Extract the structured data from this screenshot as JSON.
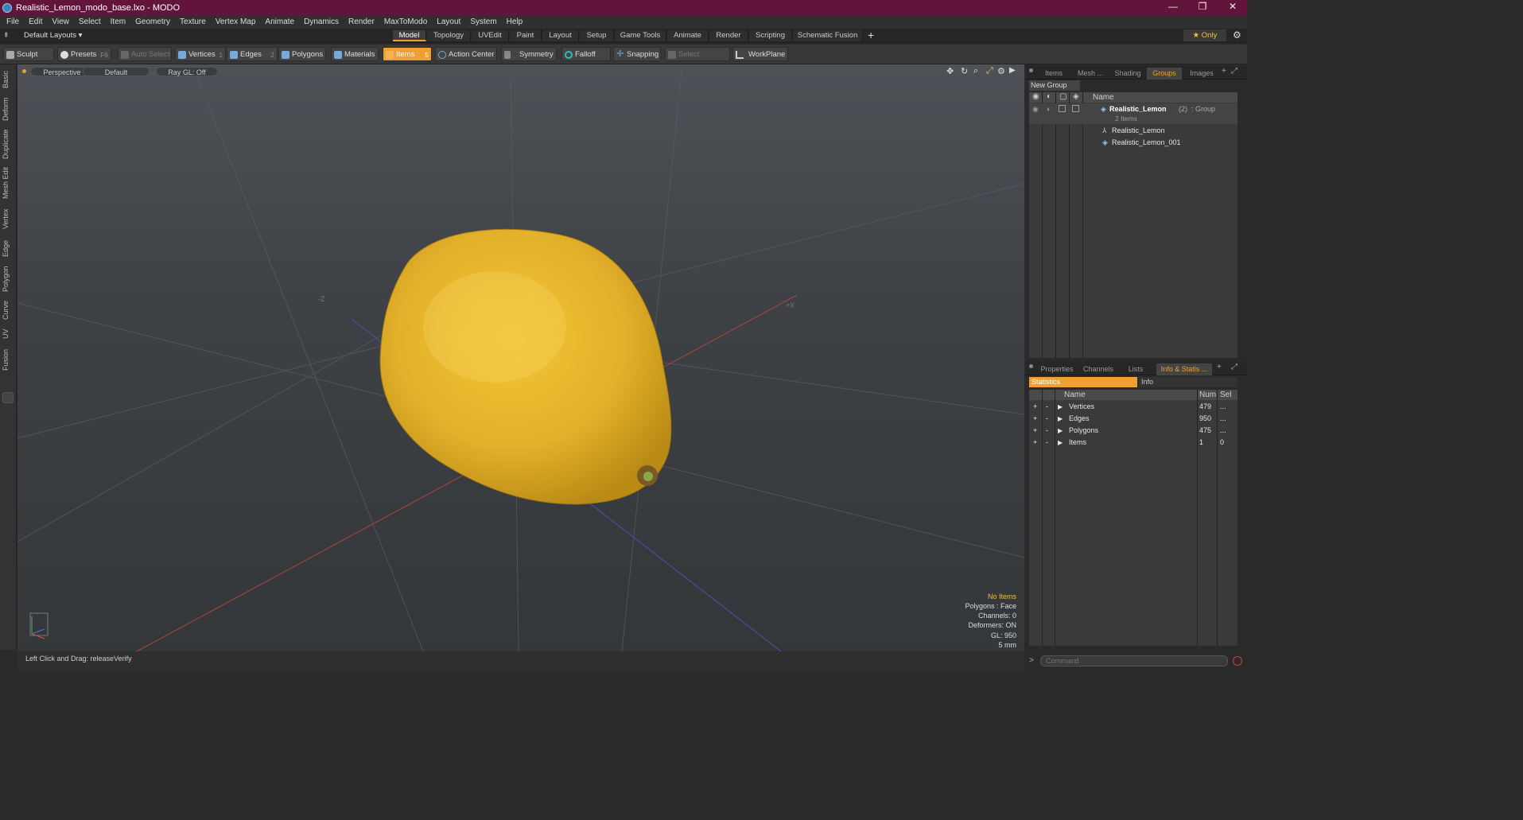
{
  "window": {
    "title": "Realistic_Lemon_modo_base.lxo - MODO",
    "minimize": "—",
    "maximize": "❐",
    "close": "✕"
  },
  "menu": [
    "File",
    "Edit",
    "View",
    "Select",
    "Item",
    "Geometry",
    "Texture",
    "Vertex Map",
    "Animate",
    "Dynamics",
    "Render",
    "MaxToModo",
    "Layout",
    "System",
    "Help"
  ],
  "layout": {
    "selector": "Default Layouts ▾",
    "tabs": [
      "Model",
      "Topology",
      "UVEdit",
      "Paint",
      "Layout",
      "Setup",
      "Game Tools",
      "Animate",
      "Render",
      "Scripting",
      "Schematic Fusion"
    ],
    "active_tab": "Model",
    "add": "+",
    "only": "★  Only"
  },
  "toolbar": {
    "sculpt": "Sculpt",
    "presets": "Presets",
    "presets_key": "F6",
    "auto_select": "Auto Select",
    "vertices": "Vertices",
    "vertices_key": "1",
    "edges": "Edges",
    "edges_key": "2",
    "polygons": "Polygons",
    "materials": "Materials",
    "items": "Items",
    "items_key": "5",
    "action_center": "Action Center",
    "symmetry": "Symmetry",
    "falloff": "Falloff",
    "snapping": "Snapping",
    "select_through": "Select Through",
    "workplane": "WorkPlane"
  },
  "left_tabs": [
    "Basic",
    "Deform",
    "Duplicate",
    "Mesh Edit",
    "Vertex",
    "Edge",
    "Polygon",
    "Curve",
    "UV",
    "Fusion"
  ],
  "viewport": {
    "view": "Perspective",
    "shading": "Default",
    "raygl": "Ray GL: Off",
    "axis_neg_z": "-Z",
    "axis_pos_x": "+X",
    "info": {
      "items": "No Items",
      "polygons": "Polygons : Face",
      "channels": "Channels: 0",
      "deformers": "Deformers: ON",
      "gl": "GL: 950",
      "unit": "5 mm"
    }
  },
  "status": {
    "hint": "Left Click and Drag:  releaseVerify"
  },
  "groups_panel": {
    "tabs": [
      "Items",
      "Mesh ...",
      "Shading",
      "Groups",
      "Images"
    ],
    "active": "Groups",
    "new_group": "New Group",
    "col_name": "Name",
    "group_name": "Realistic_Lemon",
    "group_count": "(2)",
    "group_type": ": Group",
    "group_items": "2 Items",
    "children": [
      "Realistic_Lemon",
      "Realistic_Lemon_001"
    ]
  },
  "stats_panel": {
    "tabs": [
      "Properties",
      "Channels",
      "Lists",
      "Info & Statis ..."
    ],
    "active": "Info & Statis ...",
    "sub_statistics": "Statistics",
    "sub_info": "Info",
    "headers": {
      "name": "Name",
      "num": "Num",
      "sel": "Sel"
    },
    "rows": [
      {
        "name": "Vertices",
        "num": "479",
        "sel": "..."
      },
      {
        "name": "Edges",
        "num": "950",
        "sel": "..."
      },
      {
        "name": "Polygons",
        "num": "475",
        "sel": "..."
      },
      {
        "name": "Items",
        "num": "1",
        "sel": "0"
      }
    ]
  },
  "command": {
    "placeholder": "Command"
  },
  "colors": {
    "title_bar": "#63143a",
    "accent": "#f0a030",
    "lemon": "#e8b82a"
  }
}
